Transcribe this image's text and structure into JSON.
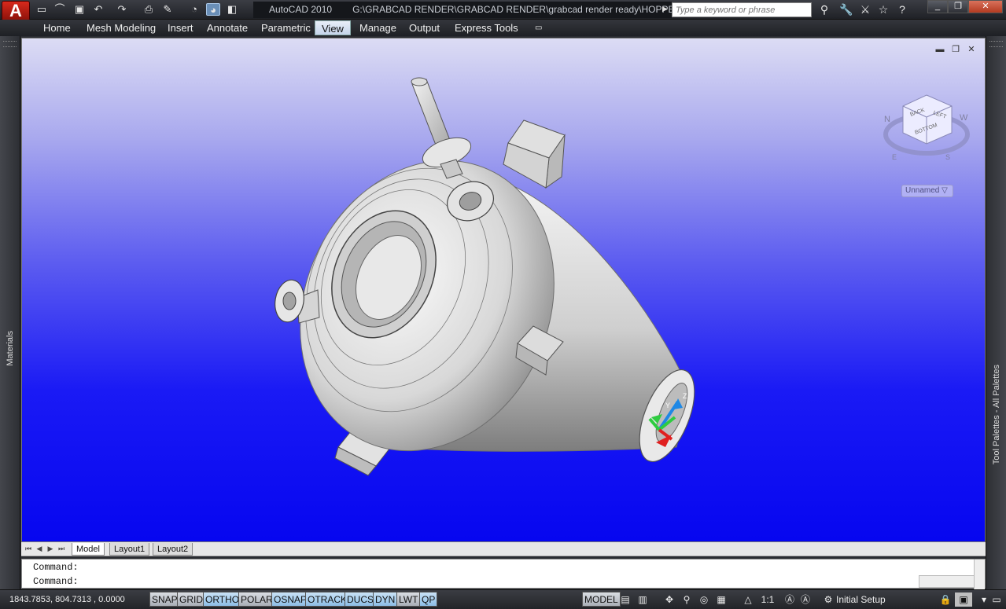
{
  "titlebar": {
    "app_title": "AutoCAD 2010",
    "file_path": "G:\\GRABCAD RENDER\\GRABCAD RENDER\\grabcad render ready\\HOPPER.dw",
    "search_placeholder": "Type a keyword or phrase",
    "logo_letter": "A",
    "window_controls": [
      "_",
      "❐",
      "✕"
    ]
  },
  "menu": {
    "items": [
      "Home",
      "Mesh Modeling",
      "Insert",
      "Annotate",
      "Parametric",
      "View",
      "Manage",
      "Output",
      "Express Tools"
    ],
    "active": "View"
  },
  "palettes": {
    "left_label": "Materials",
    "right_label": "Tool Palettes - All Palettes"
  },
  "viewport": {
    "named_view": "Unnamed ▽",
    "viewcube": {
      "faces": [
        "BACK",
        "LEFT",
        "BOTTOM"
      ],
      "compass": [
        "N",
        "W",
        "S",
        "E"
      ]
    },
    "ucs_axes": [
      "X",
      "Y",
      "Z"
    ]
  },
  "layout_tabs": {
    "tabs": [
      "Model",
      "Layout1",
      "Layout2"
    ],
    "active": "Model"
  },
  "command": {
    "lines": [
      "Command:",
      "Command:"
    ]
  },
  "status": {
    "coordinates": "1843.7853, 804.7313 , 0.0000",
    "toggles": [
      {
        "label": "SNAP",
        "on": false
      },
      {
        "label": "GRID",
        "on": false
      },
      {
        "label": "ORTHO",
        "on": true
      },
      {
        "label": "POLAR",
        "on": false
      },
      {
        "label": "OSNAP",
        "on": true
      },
      {
        "label": "OTRACK",
        "on": true
      },
      {
        "label": "DUCS",
        "on": true
      },
      {
        "label": "DYN",
        "on": true
      },
      {
        "label": "LWT",
        "on": false
      },
      {
        "label": "QP",
        "on": true
      }
    ],
    "space": "MODEL",
    "annotation_scale": "1:1",
    "workspace": "Initial Setup Workspace"
  }
}
